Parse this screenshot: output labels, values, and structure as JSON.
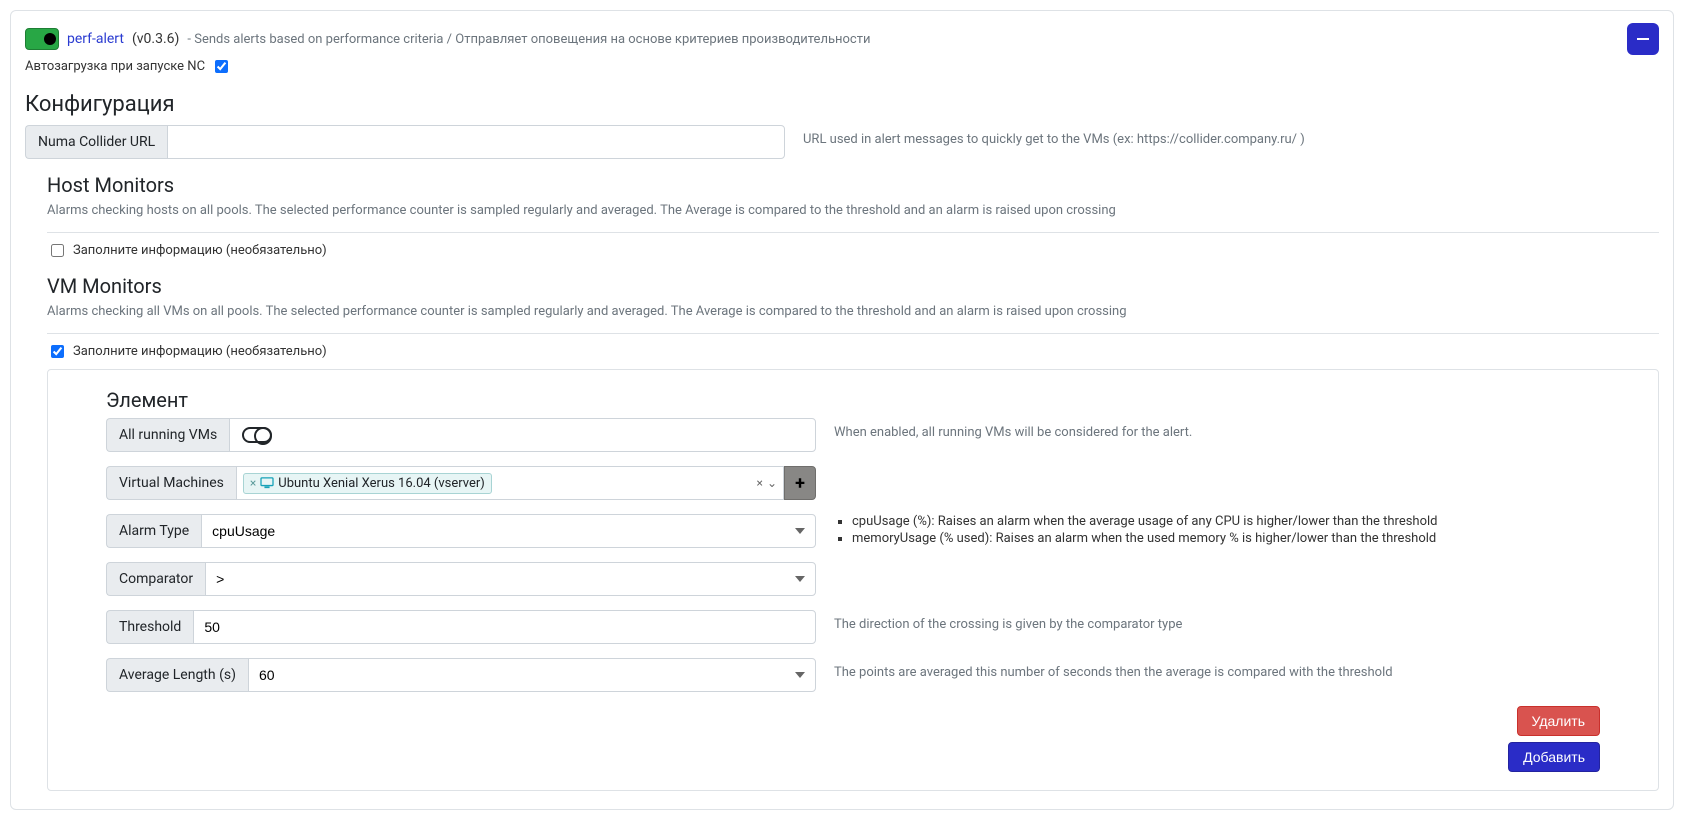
{
  "header": {
    "plugin_name": "perf-alert",
    "plugin_version": "(v0.3.6)",
    "plugin_desc": "- Sends alerts based on performance criteria / Отправляет оповещения на основе критериев производительности",
    "autoload_label": "Автозагрузка при запуске NC"
  },
  "config": {
    "title": "Конфигурация",
    "url_label": "Numa Collider URL",
    "url_value": "",
    "url_help": "URL used in alert messages to quickly get to the VMs (ex: https://collider.company.ru/ )"
  },
  "host_monitors": {
    "title": "Host Monitors",
    "desc": "Alarms checking hosts on all pools. The selected performance counter is sampled regularly and averaged. The Average is compared to the threshold and an alarm is raised upon crossing",
    "fill_label": "Заполните информацию (необязательно)"
  },
  "vm_monitors": {
    "title": "VM Monitors",
    "desc": "Alarms checking all VMs on all pools. The selected performance counter is sampled regularly and averaged. The Average is compared to the threshold and an alarm is raised upon crossing",
    "fill_label": "Заполните информацию (необязательно)"
  },
  "element": {
    "title": "Элемент",
    "all_running_label": "All running VMs",
    "all_running_help": "When enabled, all running VMs will be considered for the alert.",
    "vms_label": "Virtual Machines",
    "vm_tag": "Ubuntu Xenial Xerus 16.04 (vserver)",
    "alarm_type_label": "Alarm Type",
    "alarm_type_value": "cpuUsage",
    "alarm_help_1": "cpuUsage (%): Raises an alarm when the average usage of any CPU is higher/lower than the threshold",
    "alarm_help_2": "memoryUsage (% used): Raises an alarm when the used memory % is higher/lower than the threshold",
    "comparator_label": "Comparator",
    "comparator_value": ">",
    "threshold_label": "Threshold",
    "threshold_value": "50",
    "threshold_help": "The direction of the crossing is given by the comparator type",
    "avglen_label": "Average Length (s)",
    "avglen_value": "60",
    "avglen_help": "The points are averaged this number of seconds then the average is compared with the threshold",
    "delete_btn": "Удалить",
    "add_btn": "Добавить"
  }
}
